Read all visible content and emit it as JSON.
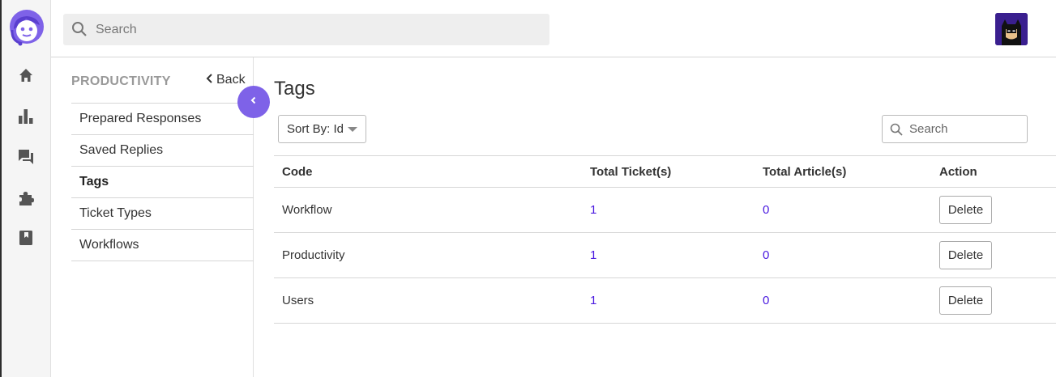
{
  "colors": {
    "accent": "#7e62e8",
    "link": "#4b1be0",
    "rail_bg": "#f5f5f5"
  },
  "rail": {
    "logo_icon": "agent-headset-logo-icon",
    "items": [
      {
        "icon": "home-icon"
      },
      {
        "icon": "bar-chart-icon"
      },
      {
        "icon": "chat-bubbles-icon"
      },
      {
        "icon": "puzzle-icon"
      },
      {
        "icon": "bookmark-book-icon"
      }
    ]
  },
  "topbar": {
    "search_placeholder": "Search",
    "avatar_icon": "user-avatar-icon"
  },
  "subnav": {
    "title": "PRODUCTIVITY",
    "back_label": "Back",
    "items": [
      {
        "label": "Prepared Responses",
        "active": false
      },
      {
        "label": "Saved Replies",
        "active": false
      },
      {
        "label": "Tags",
        "active": true
      },
      {
        "label": "Ticket Types",
        "active": false
      },
      {
        "label": "Workflows",
        "active": false
      }
    ]
  },
  "main": {
    "title": "Tags",
    "sort_label": "Sort By: Id",
    "search_placeholder": "Search",
    "table": {
      "headers": [
        "Code",
        "Total Ticket(s)",
        "Total Article(s)",
        "Action"
      ],
      "rows": [
        {
          "code": "Workflow",
          "tickets": "1",
          "articles": "0",
          "action": "Delete"
        },
        {
          "code": "Productivity",
          "tickets": "1",
          "articles": "0",
          "action": "Delete"
        },
        {
          "code": "Users",
          "tickets": "1",
          "articles": "0",
          "action": "Delete"
        }
      ]
    }
  }
}
